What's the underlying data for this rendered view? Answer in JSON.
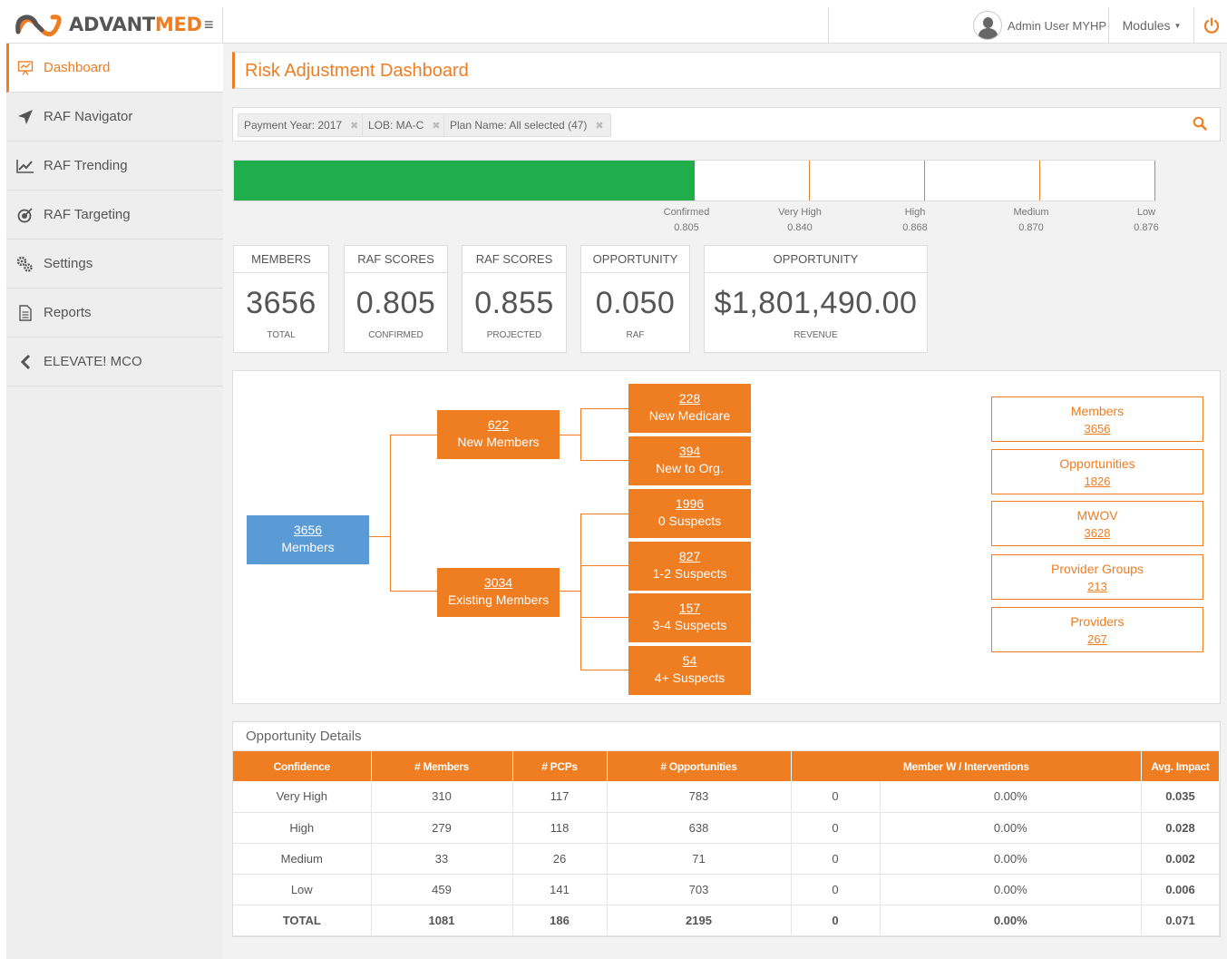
{
  "brand": {
    "name_part1": "ADVANT",
    "name_part2": "MED",
    "accent": "#ef7d22"
  },
  "topbar": {
    "user_name": "Admin User MYHP",
    "modules_label": "Modules"
  },
  "sidebar": {
    "items": [
      {
        "label": "Dashboard",
        "icon": "presentation-icon"
      },
      {
        "label": "RAF Navigator",
        "icon": "navigate-arrow-icon"
      },
      {
        "label": "RAF Trending",
        "icon": "trend-chart-icon"
      },
      {
        "label": "RAF Targeting",
        "icon": "target-icon"
      },
      {
        "label": "Settings",
        "icon": "gears-icon"
      },
      {
        "label": "Reports",
        "icon": "document-icon"
      },
      {
        "label": "ELEVATE! MCO",
        "icon": "chevron-left-icon"
      }
    ]
  },
  "page": {
    "title": "Risk Adjustment Dashboard"
  },
  "filters": [
    {
      "label": "Payment Year: 2017"
    },
    {
      "label": "LOB: MA-C"
    },
    {
      "label": "Plan Name: All selected (47)"
    }
  ],
  "progress": {
    "fill_fraction": 0.5,
    "fill_color": "#1fae4b",
    "markers": [
      {
        "label": "Confirmed",
        "value": "0.805"
      },
      {
        "label": "Very High",
        "value": "0.840"
      },
      {
        "label": "High",
        "value": "0.868"
      },
      {
        "label": "Medium",
        "value": "0.870"
      },
      {
        "label": "Low",
        "value": "0.876"
      }
    ]
  },
  "stats": [
    {
      "header": "MEMBERS",
      "value": "3656",
      "sub": "TOTAL"
    },
    {
      "header": "RAF SCORES",
      "value": "0.805",
      "sub": "CONFIRMED"
    },
    {
      "header": "RAF SCORES",
      "value": "0.855",
      "sub": "PROJECTED"
    },
    {
      "header": "OPPORTUNITY",
      "value": "0.050",
      "sub": "RAF"
    },
    {
      "header": "OPPORTUNITY",
      "value": "$1,801,490.00",
      "sub": "REVENUE"
    }
  ],
  "tree": {
    "root": {
      "num": "3656",
      "label": "Members"
    },
    "new_members": {
      "num": "622",
      "label": "New Members"
    },
    "existing_members": {
      "num": "3034",
      "label": "Existing Members"
    },
    "new_medicare": {
      "num": "228",
      "label": "New Medicare"
    },
    "new_to_org": {
      "num": "394",
      "label": "New to Org."
    },
    "s0": {
      "num": "1996",
      "label": "0 Suspects"
    },
    "s12": {
      "num": "827",
      "label": "1-2 Suspects"
    },
    "s34": {
      "num": "157",
      "label": "3-4 Suspects"
    },
    "s4p": {
      "num": "54",
      "label": "4+ Suspects"
    }
  },
  "summary_links": [
    {
      "label": "Members",
      "num": "3656"
    },
    {
      "label": "Opportunities",
      "num": "1826"
    },
    {
      "label": "MWOV",
      "num": "3628"
    },
    {
      "label": "Provider Groups",
      "num": "213"
    },
    {
      "label": "Providers",
      "num": "267"
    }
  ],
  "opportunity_table": {
    "title": "Opportunity Details",
    "headers": [
      "Confidence",
      "# Members",
      "# PCPs",
      "# Opportunities",
      "Member W / Interventions",
      "Avg. Impact"
    ],
    "rows": [
      [
        "Very High",
        "310",
        "117",
        "783",
        "0",
        "0.00%",
        "0.035"
      ],
      [
        "High",
        "279",
        "118",
        "638",
        "0",
        "0.00%",
        "0.028"
      ],
      [
        "Medium",
        "33",
        "26",
        "71",
        "0",
        "0.00%",
        "0.002"
      ],
      [
        "Low",
        "459",
        "141",
        "703",
        "0",
        "0.00%",
        "0.006"
      ],
      [
        "TOTAL",
        "1081",
        "186",
        "2195",
        "0",
        "0.00%",
        "0.071"
      ]
    ]
  }
}
